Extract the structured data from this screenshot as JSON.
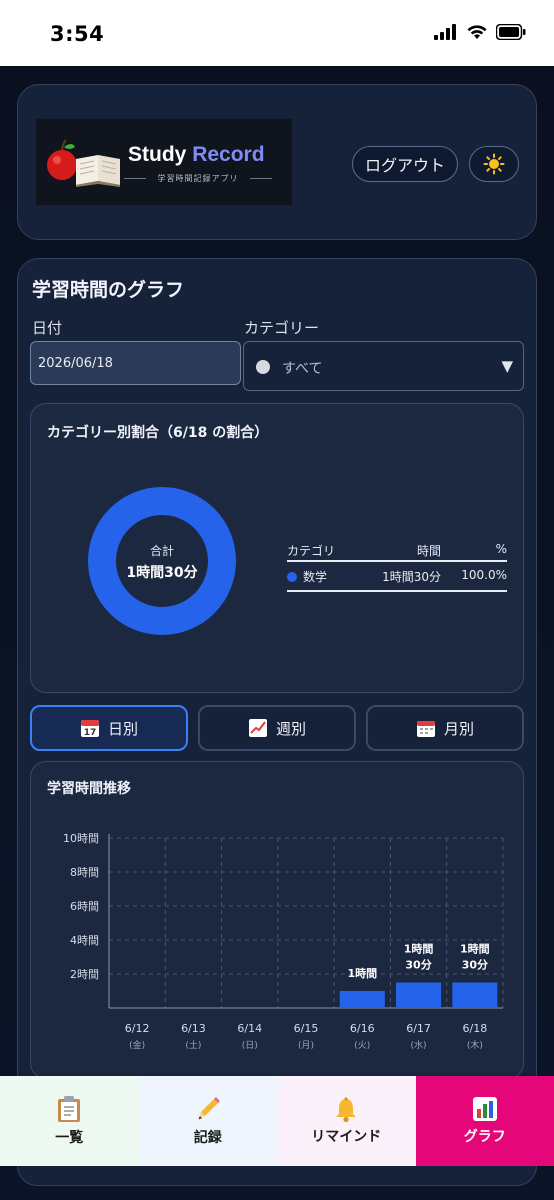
{
  "status_bar": {
    "time": "3:54"
  },
  "header": {
    "logo": {
      "title_part1": "Study",
      "title_part2": "Record",
      "subtitle": "学習時間記録アプリ"
    },
    "logout_label": "ログアウト",
    "theme_icon": "sun-icon"
  },
  "graph": {
    "title": "学習時間のグラフ",
    "date_label": "日付",
    "date_value": "2026/06/18",
    "category_label": "カテゴリー",
    "category_selected": "すべて",
    "pie": {
      "title": "カテゴリー別割合（6/18 の割合）",
      "total_label": "合計",
      "total_value": "1時間30分",
      "table_headers": [
        "カテゴリ",
        "時間",
        "%"
      ],
      "rows": [
        {
          "category": "数学",
          "time": "1時間30分",
          "percent": "100.0%",
          "color": "#2563eb"
        }
      ]
    },
    "tabs": [
      {
        "label": "日別",
        "icon": "calendar-icon",
        "active": true
      },
      {
        "label": "週別",
        "icon": "chart-increasing-icon",
        "active": false
      },
      {
        "label": "月別",
        "icon": "spiral-calendar-icon",
        "active": false
      }
    ],
    "trend": {
      "title": "学習時間推移"
    }
  },
  "chart_data": [
    {
      "type": "pie",
      "title": "カテゴリー別割合（6/18 の割合）",
      "categories": [
        "数学"
      ],
      "values": [
        100.0
      ],
      "colors": [
        "#2563eb"
      ],
      "center_label": "合計",
      "center_value": "1時間30分"
    },
    {
      "type": "bar",
      "title": "学習時間推移",
      "categories": [
        "6/12",
        "6/13",
        "6/14",
        "6/15",
        "6/16",
        "6/17",
        "6/18"
      ],
      "weekdays": [
        "(金)",
        "(土)",
        "(日)",
        "(月)",
        "(火)",
        "(水)",
        "(木)"
      ],
      "values": [
        0,
        0,
        0,
        0,
        1.0,
        1.5,
        1.5
      ],
      "data_labels": [
        "",
        "",
        "",
        "",
        "1時間",
        "1時間\n30分",
        "1時間\n30分"
      ],
      "yticks": [
        "2時間",
        "4時間",
        "6時間",
        "8時間",
        "10時間"
      ],
      "ytick_values": [
        2,
        4,
        6,
        8,
        10
      ],
      "ylim": [
        0,
        10
      ],
      "grid": true,
      "bar_color": "#2563eb"
    }
  ],
  "bottom_nav": [
    {
      "label": "一覧",
      "icon": "clipboard-icon",
      "active": false
    },
    {
      "label": "記録",
      "icon": "pencil-icon",
      "active": false
    },
    {
      "label": "リマインド",
      "icon": "bell-icon",
      "active": false
    },
    {
      "label": "グラフ",
      "icon": "bar-chart-icon",
      "active": true
    }
  ]
}
